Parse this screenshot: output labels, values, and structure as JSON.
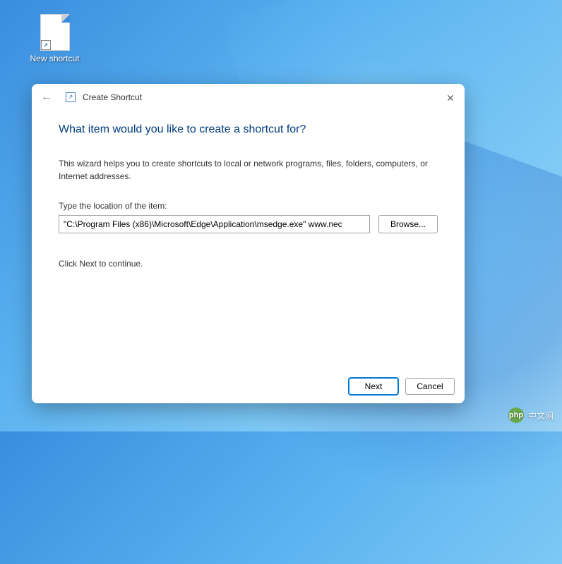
{
  "desktop": {
    "icon_label": "New shortcut"
  },
  "dialog": {
    "title": "Create Shortcut",
    "heading": "What item would you like to create a shortcut for?",
    "description": "This wizard helps you to create shortcuts to local or network programs, files, folders, computers, or Internet addresses.",
    "field_label": "Type the location of the item:",
    "location_value": "\"C:\\Program Files (x86)\\Microsoft\\Edge\\Application\\msedge.exe\" www.nec",
    "browse_label": "Browse...",
    "hint": "Click Next to continue.",
    "next_label": "Next",
    "cancel_label": "Cancel"
  },
  "watermark": {
    "logo_text": "php",
    "text": "中文网"
  }
}
